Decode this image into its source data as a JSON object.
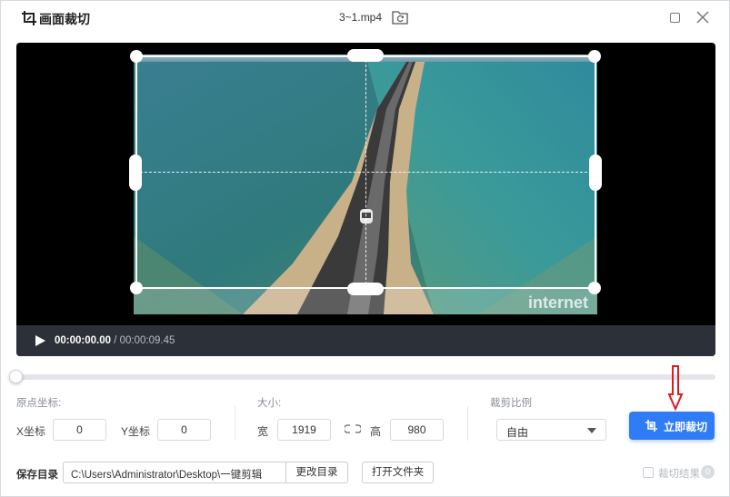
{
  "titlebar": {
    "app_title": "画面裁切",
    "file_name": "3~1.mp4"
  },
  "player": {
    "watermark": "internet",
    "current_time": "00:00:00.00",
    "separator": " / ",
    "duration": "00:00:09.45"
  },
  "settings": {
    "origin_label": "原点坐标:",
    "x_label": "X坐标",
    "x_value": "0",
    "y_label": "Y坐标",
    "y_value": "0",
    "size_label": "大小:",
    "width_label": "宽",
    "width_value": "1919",
    "height_label": "高",
    "height_value": "980",
    "ratio_label": "裁剪比例",
    "ratio_value": "自由",
    "crop_button": "立即裁切"
  },
  "bottom": {
    "save_label": "保存目录",
    "save_path": "C:\\Users\\Administrator\\Desktop\\一键剪辑",
    "change_dir": "更改目录",
    "open_folder": "打开文件夹",
    "result_label": "裁切结果",
    "result_count": "0"
  },
  "colors": {
    "accent": "#2f7cf6",
    "player_bg": "#000000",
    "controlbar_bg": "#2c3139",
    "annotation_arrow": "#e0191e"
  }
}
